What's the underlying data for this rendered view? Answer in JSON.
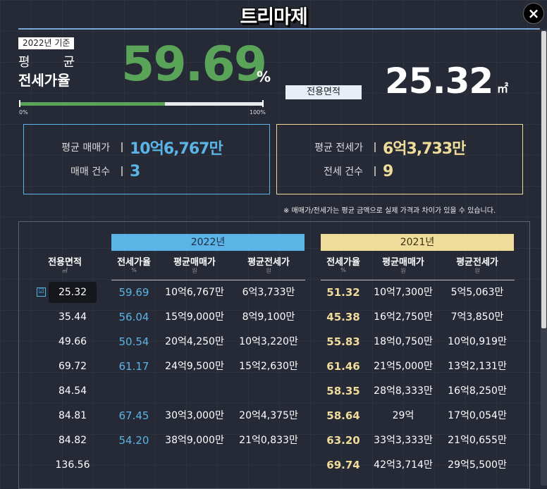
{
  "app": {
    "logo": "트리마제",
    "close_label": "×"
  },
  "summary": {
    "year_badge": "2022년 기준",
    "avg_label_1": "평",
    "avg_label_2": "균",
    "ratio_label": "전세가율",
    "ratio_value": "59.69",
    "ratio_unit": "%",
    "ratio_progress": 0.5969,
    "scale_min": "0%",
    "scale_max": "100%",
    "area_label": "전용면적",
    "area_value": "25.32",
    "area_unit": "㎡"
  },
  "sale_box": {
    "avg_label": "평균 매매가",
    "avg_value": "10억6,767만",
    "count_label": "매매 건수",
    "count_value": "3"
  },
  "jeonse_box": {
    "avg_label": "평균 전세가",
    "avg_value": "6억3,733만",
    "count_label": "전세 건수",
    "count_value": "9"
  },
  "note": "※ 매매가/전세가는 평균 금액으로 실제 가격과 차이가 있을 수 있습니다.",
  "colors": {
    "blue": "#5bb4e5",
    "gold": "#f0dc9a",
    "green": "#5aa45a"
  },
  "table": {
    "year_2022": "2022년",
    "year_2021": "2021년",
    "area_header": "전용면적",
    "area_sub": "㎡",
    "ratio_header": "전세가율",
    "ratio_sub": "%",
    "sale_header": "평균매매가",
    "jeonse_header": "평균전세가",
    "won_sub": "원",
    "checkbox_icon": "☑",
    "rows": [
      {
        "area": "25.32",
        "r22": "59.69",
        "s22": "10억6,767만",
        "j22": "6억3,733만",
        "r21": "51.32",
        "s21": "10억7,300만",
        "j21": "5억5,063만"
      },
      {
        "area": "35.44",
        "r22": "56.04",
        "s22": "15억9,000만",
        "j22": "8억9,100만",
        "r21": "45.38",
        "s21": "16억2,750만",
        "j21": "7억3,850만"
      },
      {
        "area": "49.66",
        "r22": "50.54",
        "s22": "20억4,250만",
        "j22": "10억3,220만",
        "r21": "55.83",
        "s21": "18억0,750만",
        "j21": "10억0,919만"
      },
      {
        "area": "69.72",
        "r22": "61.17",
        "s22": "24억9,500만",
        "j22": "15억2,630만",
        "r21": "61.46",
        "s21": "21억5,000만",
        "j21": "13억2,131만"
      },
      {
        "area": "84.54",
        "r22": "",
        "s22": "",
        "j22": "",
        "r21": "58.35",
        "s21": "28억8,333만",
        "j21": "16억8,250만"
      },
      {
        "area": "84.81",
        "r22": "67.45",
        "s22": "30억3,000만",
        "j22": "20억4,375만",
        "r21": "58.64",
        "s21": "29억",
        "j21": "17억0,054만"
      },
      {
        "area": "84.82",
        "r22": "54.20",
        "s22": "38억9,000만",
        "j22": "21억0,833만",
        "r21": "63.20",
        "s21": "33억3,333만",
        "j21": "21억0,655만"
      },
      {
        "area": "136.56",
        "r22": "",
        "s22": "",
        "j22": "",
        "r21": "69.74",
        "s21": "42억3,714만",
        "j21": "29억5,500만"
      }
    ]
  }
}
